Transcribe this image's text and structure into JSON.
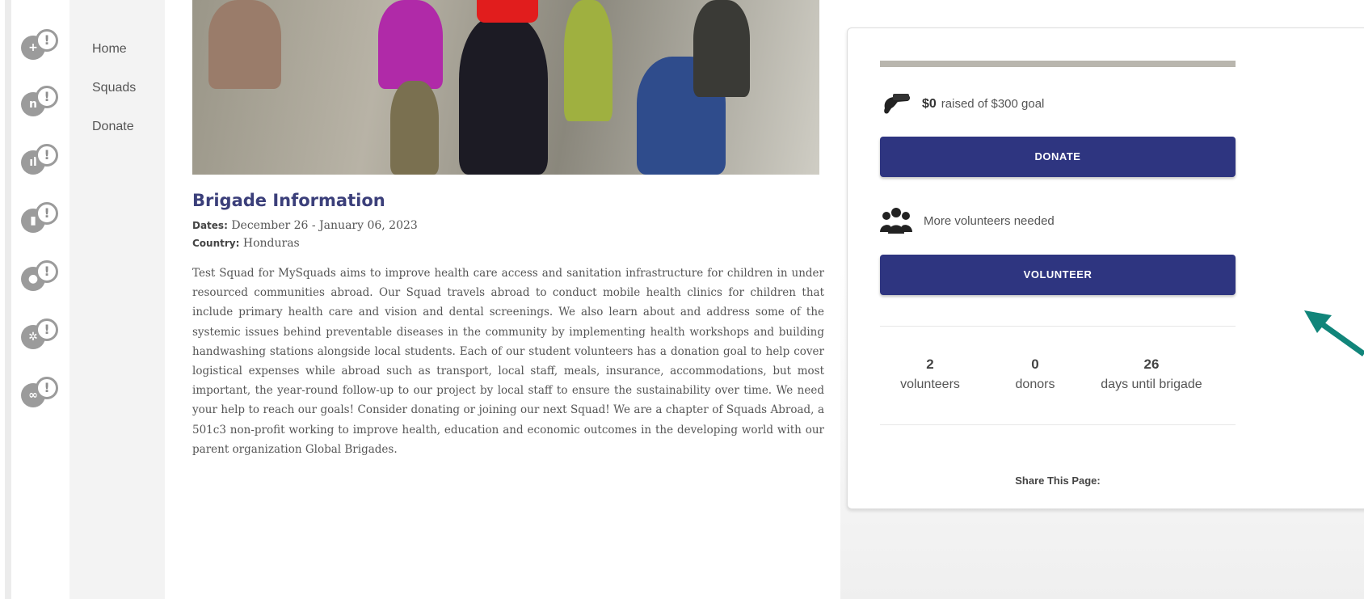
{
  "rail_icons": [
    {
      "name": "plus-alert-icon",
      "glyph": "+"
    },
    {
      "name": "tooth-alert-icon",
      "glyph": "n"
    },
    {
      "name": "chart-alert-icon",
      "glyph": "ıl"
    },
    {
      "name": "bottle-alert-icon",
      "glyph": "▮"
    },
    {
      "name": "drop-alert-icon",
      "glyph": "●"
    },
    {
      "name": "gear-alert-icon",
      "glyph": "✲"
    },
    {
      "name": "infinity-alert-icon",
      "glyph": "∞"
    }
  ],
  "nav": {
    "home": "Home",
    "squads": "Squads",
    "donate": "Donate"
  },
  "brigade": {
    "title": "Brigade Information",
    "dates_label": "Dates:",
    "dates_value": "December 26 - January 06, 2023",
    "country_label": "Country:",
    "country_value": "Honduras",
    "description": "Test Squad for MySquads aims to improve health care access and sanitation infrastructure for children in under resourced communities abroad. Our Squad travels abroad to conduct mobile health clinics for children that include primary health care and vision and dental screenings. We also learn about and address some of the systemic issues behind preventable diseases in the community by implementing health workshops and building handwashing stations alongside local students. Each of our student volunteers has a donation goal to help cover logistical expenses while abroad such as transport, local staff, meals, insurance, accommodations, but most important, the year-round follow-up to our project by local staff to ensure the sustainability over time. We need your help to reach our goals! Consider donating or joining our next Squad! We are a chapter of Squads Abroad, a 501c3 non-profit working to improve health, education and economic outcomes in the developing world with our parent organization Global Brigades."
  },
  "card": {
    "progress_fraction": 0,
    "raised_amount": "$0",
    "raised_text": "raised of $300 goal",
    "donate_label": "DONATE",
    "volunteers_needed": "More volunteers needed",
    "volunteer_label": "VOLUNTEER",
    "stats": [
      {
        "value": "2",
        "label": "volunteers"
      },
      {
        "value": "0",
        "label": "donors"
      },
      {
        "value": "26",
        "label": "days until brigade"
      }
    ],
    "share_label": "Share This Page:"
  },
  "colors": {
    "brand_navy": "#2e3580",
    "title_color": "#3b3f7a",
    "annotation_arrow": "#11857a"
  }
}
